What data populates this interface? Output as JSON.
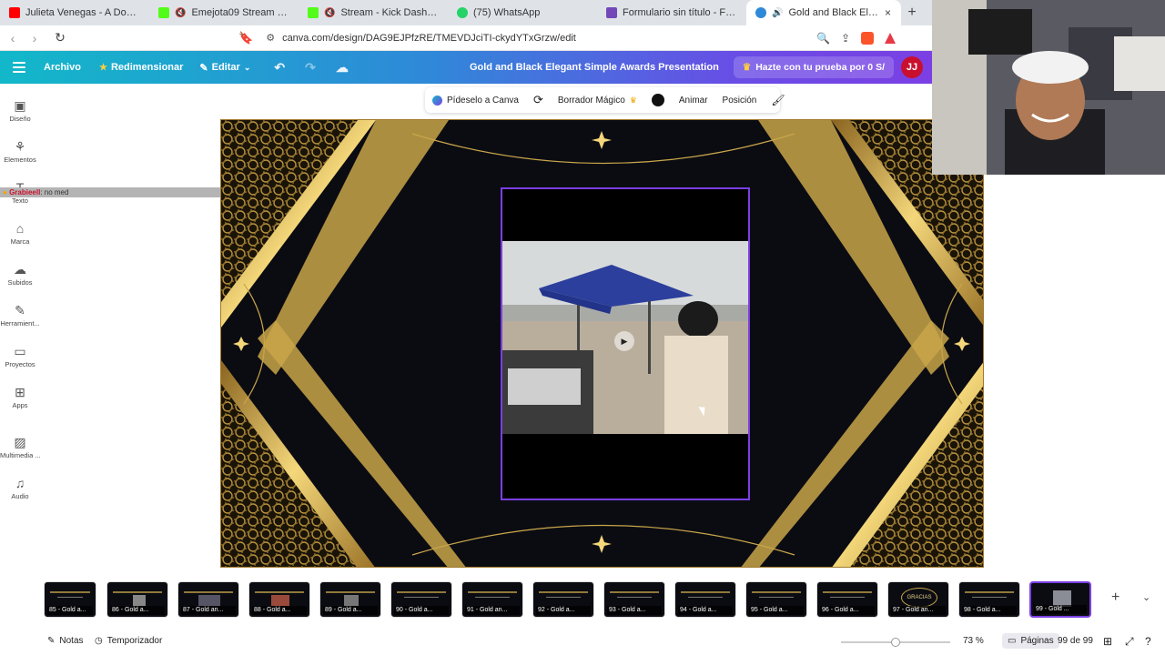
{
  "browser": {
    "tabs": [
      {
        "label": "Julieta Venegas - A Donde Va El Vien",
        "color": "#ff0000"
      },
      {
        "label": "Emejota09 Stream - Watch Live o",
        "color": "#53fc18",
        "muted": true
      },
      {
        "label": "Stream - Kick Dashboard",
        "color": "#53fc18",
        "muted": true
      },
      {
        "label": "(75) WhatsApp",
        "color": "#25d366"
      },
      {
        "label": "Formulario sin título - Formularios de",
        "color": "#7248b9"
      },
      {
        "label": "Gold and Black Elegant Simpl",
        "color": "#2e8ad8",
        "muted": true,
        "active": true
      }
    ],
    "url": "canva.com/design/DAG9EJPfzRE/TMEVDJciTI-ckydYTxGrzw/edit",
    "close_glyph": "×",
    "newtab_glyph": "+"
  },
  "header": {
    "archivo": "Archivo",
    "redimensionar": "Redimensionar",
    "editar": "Editar",
    "doc_title": "Gold and Black Elegant Simple Awards Presentation",
    "trial": "Hazte con tu prueba por 0 S/",
    "avatar": "JJ"
  },
  "sidebar": {
    "items": [
      {
        "label": "Diseño",
        "icon": "layout-icon"
      },
      {
        "label": "Elementos",
        "icon": "shapes-icon"
      },
      {
        "label": "Texto",
        "icon": "text-icon"
      },
      {
        "label": "Marca",
        "icon": "brand-icon"
      },
      {
        "label": "Subidos",
        "icon": "upload-icon"
      },
      {
        "label": "Herramient...",
        "icon": "tools-icon"
      },
      {
        "label": "Proyectos",
        "icon": "folder-icon"
      },
      {
        "label": "Apps",
        "icon": "apps-icon"
      },
      {
        "label": "Multimedia ...",
        "icon": "media-icon"
      },
      {
        "label": "Audio",
        "icon": "audio-icon"
      }
    ]
  },
  "chat_overlay": {
    "name": "Grabieell",
    "message": ": no med"
  },
  "toolbar": {
    "ask_canva": "Pídeselo a Canva",
    "magic_eraser": "Borrador Mágico",
    "animate": "Animar",
    "position": "Posición",
    "swatch_color": "#111111"
  },
  "pages": {
    "thumbs": [
      {
        "label": "85 - Gold a...",
        "kind": "text"
      },
      {
        "label": "86 - Gold a...",
        "kind": "photo"
      },
      {
        "label": "87 - Gold an...",
        "kind": "photo"
      },
      {
        "label": "88 - Gold a...",
        "kind": "photo"
      },
      {
        "label": "89 - Gold a...",
        "kind": "photo"
      },
      {
        "label": "90 - Gold a...",
        "kind": "text"
      },
      {
        "label": "91 - Gold an...",
        "kind": "text"
      },
      {
        "label": "92 - Gold a...",
        "kind": "text"
      },
      {
        "label": "93 - Gold a...",
        "kind": "text"
      },
      {
        "label": "94 - Gold a...",
        "kind": "text"
      },
      {
        "label": "95 - Gold a...",
        "kind": "text"
      },
      {
        "label": "96 - Gold a...",
        "kind": "text"
      },
      {
        "label": "97 - Gold an...",
        "kind": "gracias",
        "caption": "GRACIAS"
      },
      {
        "label": "98 - Gold a...",
        "kind": "text"
      },
      {
        "label": "99 - Gold ...",
        "kind": "photo",
        "active": true
      }
    ]
  },
  "bottom": {
    "notes": "Notas",
    "timer": "Temporizador",
    "zoom": "73 %",
    "zoom_fraction": 0.5,
    "pages_label": "Páginas",
    "page_count": "99 de 99"
  },
  "colors": {
    "gold": "#c9a64a",
    "canvas_bg": "#0b0c12",
    "selection": "#7b3fe4"
  }
}
